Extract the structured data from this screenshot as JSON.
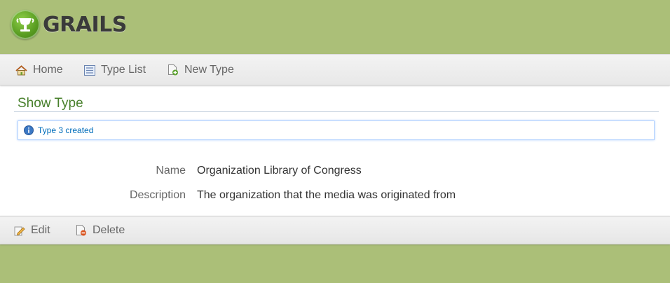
{
  "header": {
    "logo_text": "GRAILS"
  },
  "nav": {
    "items": [
      {
        "label": "Home",
        "icon": "home-icon"
      },
      {
        "label": "Type List",
        "icon": "list-icon"
      },
      {
        "label": "New Type",
        "icon": "new-document-icon"
      }
    ]
  },
  "page": {
    "title": "Show Type"
  },
  "message": {
    "text": "Type 3 created",
    "icon": "info-icon"
  },
  "properties": [
    {
      "label": "Name",
      "value": "Organization Library of Congress"
    },
    {
      "label": "Description",
      "value": "The organization that the media was originated from"
    }
  ],
  "buttons": {
    "edit_label": "Edit",
    "delete_label": "Delete"
  },
  "colors": {
    "header_bg": "#abbf78",
    "title_green": "#48802c",
    "message_blue": "#006dba",
    "text_gray": "#666666"
  }
}
